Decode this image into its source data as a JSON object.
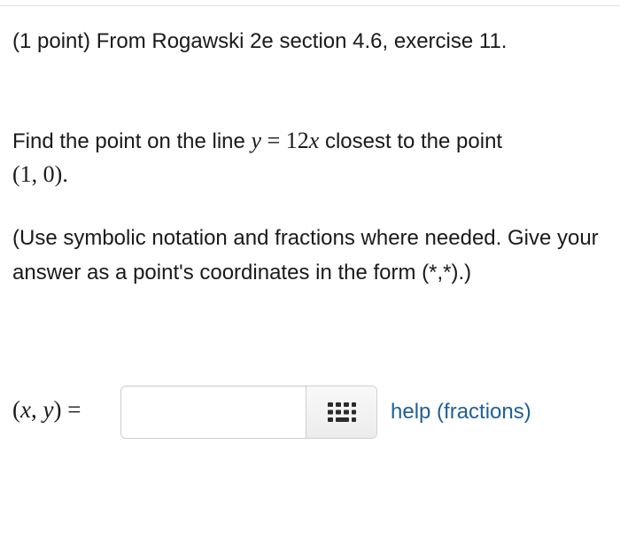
{
  "header": {
    "title": "(1 point) From Rogawski 2e section 4.6, exercise 11."
  },
  "problem": {
    "text_before": "Find the point on the line ",
    "equation_lhs": "y",
    "equation_eq": " = ",
    "equation_coef": "12",
    "equation_var": "x",
    "text_after": " closest to the point",
    "point": "(1, 0)",
    "period": "."
  },
  "instructions": {
    "text": "(Use symbolic notation and fractions where needed. Give your answer as a point's coordinates in the form (*,*).)"
  },
  "answer": {
    "label_open": "(",
    "label_x": "x",
    "label_sep": ", ",
    "label_y": "y",
    "label_close": ") =",
    "value": "",
    "placeholder": ""
  },
  "palette": {
    "icon": "grid-icon"
  },
  "help": {
    "label": "help (fractions)"
  },
  "colors": {
    "link": "#1f5f97",
    "border": "#cfcfcf",
    "text": "#1a1a1a"
  }
}
